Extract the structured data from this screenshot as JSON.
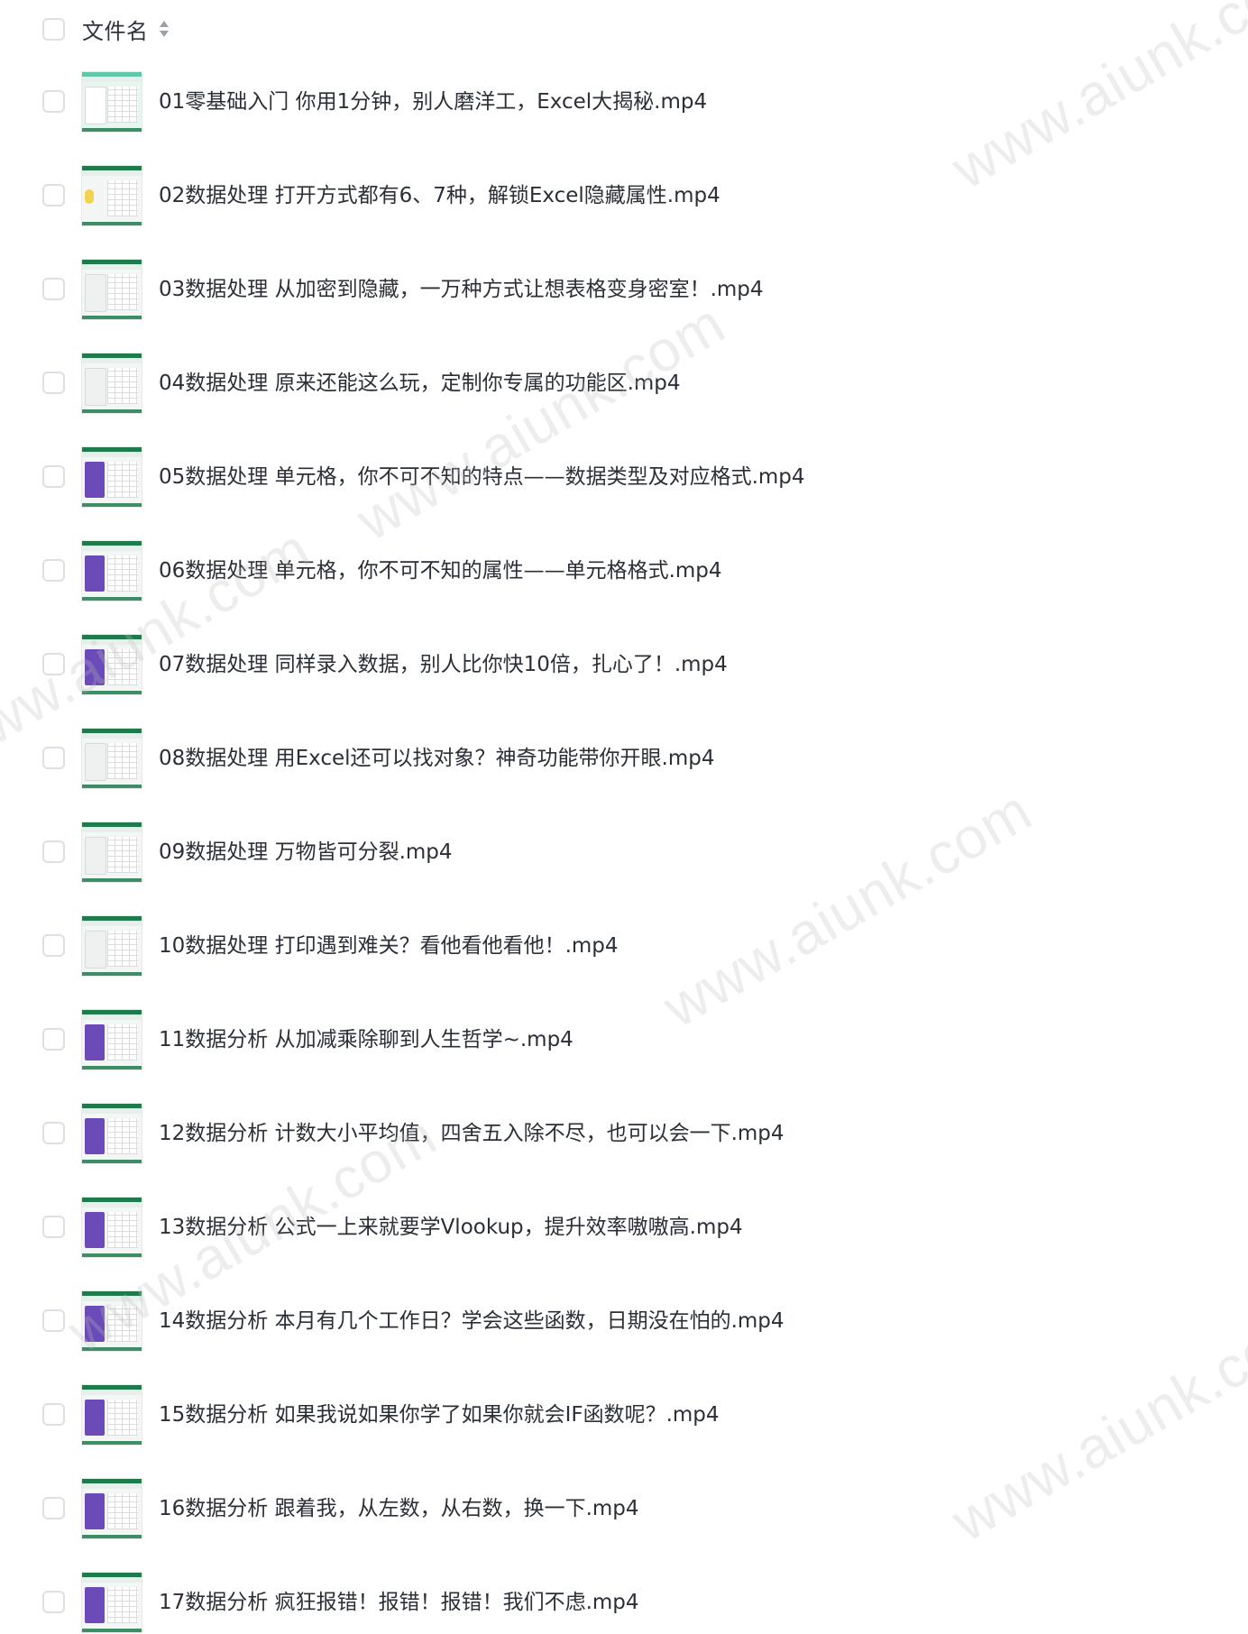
{
  "header": {
    "column_title": "文件名",
    "sort_icon": "sort-icon"
  },
  "files": [
    {
      "name": "01零基础入门 你用1分钟，别人磨洋工，Excel大揭秘.mp4",
      "thumb_style": "cyan"
    },
    {
      "name": "02数据处理 打开方式都有6、7种，解锁Excel隐藏属性.mp4",
      "thumb_style": "yellow"
    },
    {
      "name": "03数据处理 从加密到隐藏，一万种方式让想表格变身密室！.mp4",
      "thumb_style": "light"
    },
    {
      "name": "04数据处理 原来还能这么玩，定制你专属的功能区.mp4",
      "thumb_style": "light"
    },
    {
      "name": "05数据处理 单元格，你不可不知的特点——数据类型及对应格式.mp4",
      "thumb_style": "purple"
    },
    {
      "name": "06数据处理 单元格，你不可不知的属性——单元格格式.mp4",
      "thumb_style": "purple"
    },
    {
      "name": "07数据处理 同样录入数据，别人比你快10倍，扎心了！.mp4",
      "thumb_style": "purple"
    },
    {
      "name": "08数据处理 用Excel还可以找对象？神奇功能带你开眼.mp4",
      "thumb_style": "light"
    },
    {
      "name": "09数据处理 万物皆可分裂.mp4",
      "thumb_style": "light"
    },
    {
      "name": "10数据处理 打印遇到难关？看他看他看他！.mp4",
      "thumb_style": "light"
    },
    {
      "name": "11数据分析 从加减乘除聊到人生哲学~.mp4",
      "thumb_style": "purple"
    },
    {
      "name": "12数据分析 计数大小平均值，四舍五入除不尽，也可以会一下.mp4",
      "thumb_style": "purple"
    },
    {
      "name": "13数据分析 公式一上来就要学Vlookup，提升效率嗷嗷高.mp4",
      "thumb_style": "purple"
    },
    {
      "name": "14数据分析 本月有几个工作日？学会这些函数，日期没在怕的.mp4",
      "thumb_style": "purple"
    },
    {
      "name": "15数据分析 如果我说如果你学了如果你就会IF函数呢？.mp4",
      "thumb_style": "purple"
    },
    {
      "name": "16数据分析 跟着我，从左数，从右数，换一下.mp4",
      "thumb_style": "purple"
    },
    {
      "name": "17数据分析 疯狂报错！报错！报错！我们不虑.mp4",
      "thumb_style": "purple"
    }
  ],
  "watermark": "www.aiunk.com",
  "colors": {
    "excel_green": "#1f7a4d",
    "purple": "#6a4bb7",
    "text": "#2b2f36",
    "checkbox_border": "#dcdfe5"
  }
}
